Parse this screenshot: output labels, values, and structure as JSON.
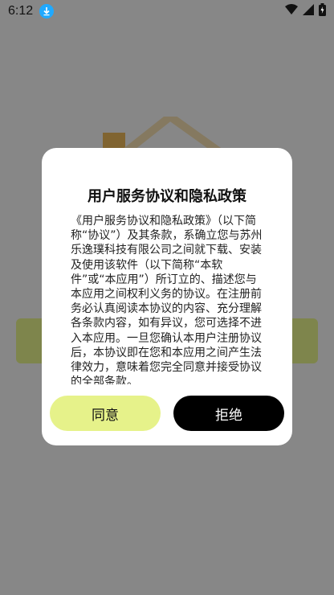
{
  "status_bar": {
    "time": "6:12",
    "download_icon": "download-icon",
    "wifi_icon": "wifi-icon",
    "signal_icon": "signal-icon",
    "battery_icon": "battery-icon"
  },
  "dialog": {
    "title": "用户服务协议和隐私政策",
    "body": "《用户服务协议和隐私政策》（以下简称“协议”）及其条款，系确立您与苏州乐逸璞科技有限公司之间就下载、安装及使用该软件（以下简称“本软件”或“本应用”）所订立的、描述您与本应用之间权利义务的协议。在注册前务必认真阅读本协议的内容、充分理解各条款内容，如有异议，您可选择不进入本应用。一旦您确认本用户注册协议后，本协议即在您和本应用之间产生法律效力，意味着您完全同意并接受协议的全部条款。",
    "agree_label": "同意",
    "reject_label": "拒绝"
  },
  "colors": {
    "accent": "#e6f28a",
    "reject": "#000000",
    "overlay": "rgba(0,0,0,0.45)"
  }
}
